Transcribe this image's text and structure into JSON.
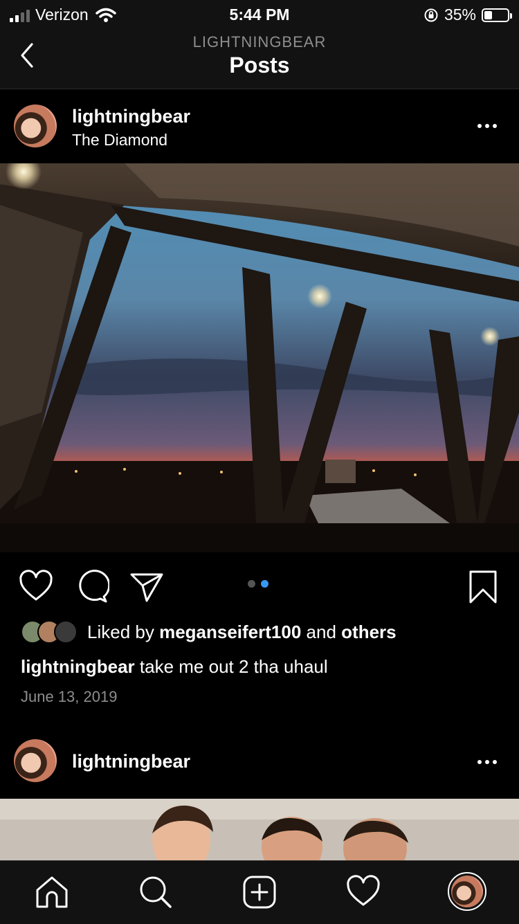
{
  "status_bar": {
    "carrier": "Verizon",
    "time": "5:44 PM",
    "battery_percent": "35%",
    "battery_level": 0.35,
    "signal_bars": 4,
    "signal_bars_active": 2,
    "icons": [
      "signal-icon",
      "wifi-icon",
      "orientation-lock-icon",
      "battery-icon"
    ]
  },
  "header": {
    "subtitle": "LIGHTNINGBEAR",
    "title": "Posts",
    "back_icon": "chevron-left-icon"
  },
  "posts": [
    {
      "username": "lightningbear",
      "location": "The Diamond",
      "image_count": 2,
      "image_index": 2,
      "liked_by": {
        "prefix": "Liked by",
        "user": "meganseifert100",
        "conjunction": "and",
        "others": "others"
      },
      "caption_user": "lightningbear",
      "caption_text": "take me out 2 tha uhaul",
      "date": "June 13, 2019"
    },
    {
      "username": "lightningbear"
    }
  ],
  "tab_bar": {
    "tabs": [
      "home-icon",
      "search-icon",
      "new-post-icon",
      "activity-heart-icon",
      "profile-avatar"
    ]
  },
  "colors": {
    "background": "#000000",
    "bar_background": "#121212",
    "accent_blue": "#3897f0",
    "secondary_text": "#8e8e8e"
  }
}
